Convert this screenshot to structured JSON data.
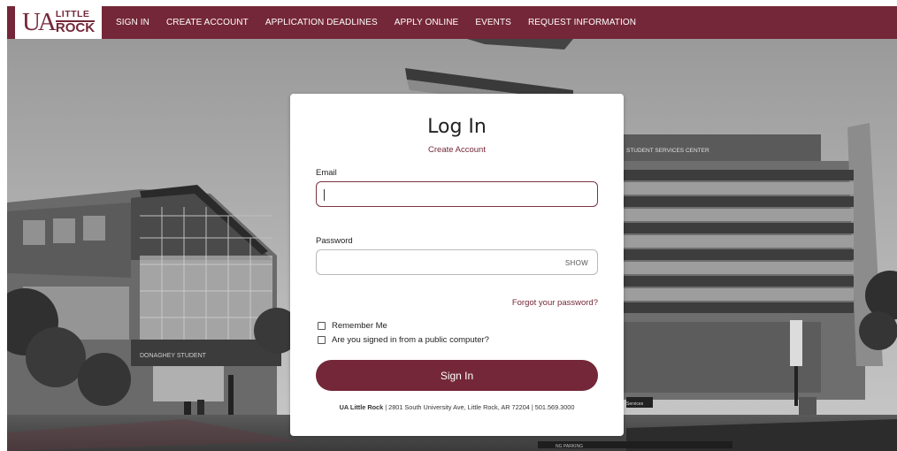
{
  "logo": {
    "ua": "UA",
    "line1": "LITTLE",
    "line2": "ROCK"
  },
  "nav": [
    "SIGN IN",
    "CREATE ACCOUNT",
    "APPLICATION DEADLINES",
    "APPLY ONLINE",
    "EVENTS",
    "REQUEST INFORMATION"
  ],
  "background": {
    "building_sign": "STUDENT SERVICES CENTER",
    "building_left_sign": "DONAGHEY STUDENT",
    "small_sign": "Services",
    "parking_sign": "NG PARKING"
  },
  "login": {
    "title": "Log In",
    "create_account": "Create Account",
    "email_label": "Email",
    "email_value": "",
    "password_label": "Password",
    "password_value": "",
    "show_label": "SHOW",
    "forgot_label": "Forgot your password?",
    "remember_label": "Remember Me",
    "public_label": "Are you signed in from a public computer?",
    "signin_label": "Sign In",
    "footer_name": "UA Little Rock",
    "footer_rest": " | 2801 South University Ave, Little Rock, AR 72204 | 501.569.3000"
  },
  "colors": {
    "brand": "#742738"
  }
}
